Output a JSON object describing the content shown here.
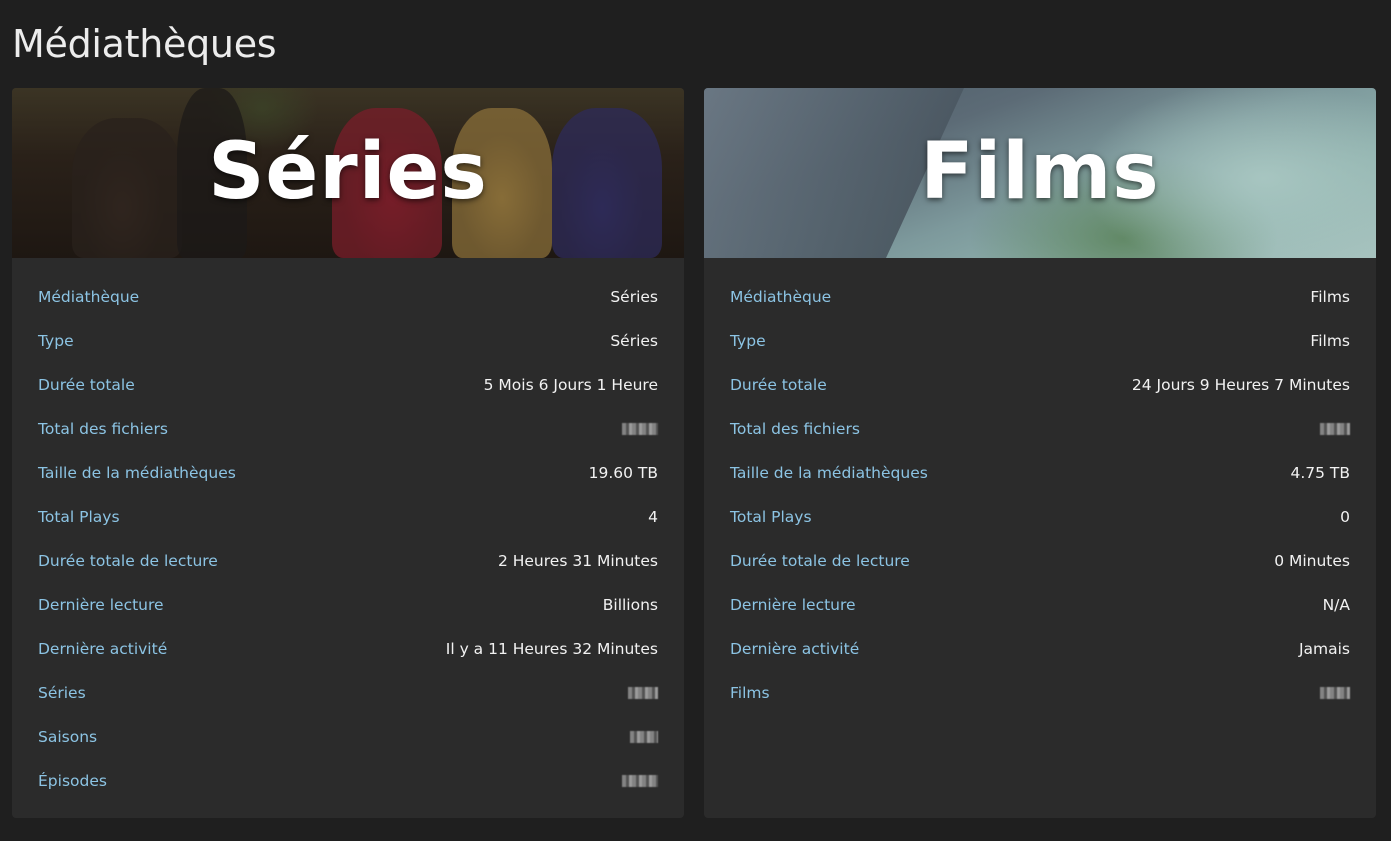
{
  "page": {
    "title": "Médiathèques"
  },
  "libraries": [
    {
      "banner_title": "Séries",
      "rows": [
        {
          "label": "Médiathèque",
          "value": "Séries"
        },
        {
          "label": "Type",
          "value": "Séries"
        },
        {
          "label": "Durée totale",
          "value": "5 Mois 6 Jours 1 Heure"
        },
        {
          "label": "Total des fichiers",
          "value": ""
        },
        {
          "label": "Taille de la médiathèques",
          "value": "19.60 TB"
        },
        {
          "label": "Total Plays",
          "value": "4"
        },
        {
          "label": "Durée totale de lecture",
          "value": "2 Heures 31 Minutes"
        },
        {
          "label": "Dernière lecture",
          "value": "Billions"
        },
        {
          "label": "Dernière activité",
          "value": "Il y a 11 Heures 32 Minutes"
        },
        {
          "label": "Séries",
          "value": ""
        },
        {
          "label": "Saisons",
          "value": ""
        },
        {
          "label": "Épisodes",
          "value": ""
        }
      ]
    },
    {
      "banner_title": "Films",
      "rows": [
        {
          "label": "Médiathèque",
          "value": "Films"
        },
        {
          "label": "Type",
          "value": "Films"
        },
        {
          "label": "Durée totale",
          "value": "24 Jours 9 Heures 7 Minutes"
        },
        {
          "label": "Total des fichiers",
          "value": ""
        },
        {
          "label": "Taille de la médiathèques",
          "value": "4.75 TB"
        },
        {
          "label": "Total Plays",
          "value": "0"
        },
        {
          "label": "Durée totale de lecture",
          "value": "0 Minutes"
        },
        {
          "label": "Dernière lecture",
          "value": "N/A"
        },
        {
          "label": "Dernière activité",
          "value": "Jamais"
        },
        {
          "label": "Films",
          "value": ""
        }
      ]
    }
  ]
}
